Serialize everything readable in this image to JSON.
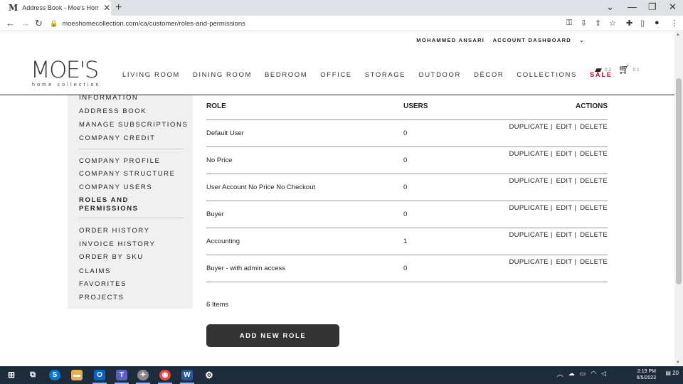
{
  "browser": {
    "tab_title": "Address Book - Moe's Home Coll",
    "tab_favicon": "M",
    "url": "moeshomecollection.com/ca/customer/roles-and-permissions"
  },
  "header": {
    "user_name": "MOHAMMED ANSARI",
    "account_dashboard": "ACCOUNT DASHBOARD",
    "logo_main": "MOE'S",
    "logo_sub": "home collection",
    "nav": [
      "LIVING ROOM",
      "DINING ROOM",
      "BEDROOM",
      "OFFICE",
      "STORAGE",
      "OUTDOOR",
      "DÉCOR",
      "COLLECTIONS",
      "SALE"
    ],
    "folder_count": "0 2",
    "cart_count": "0 1"
  },
  "sidebar": {
    "group1": [
      "INFORMATION",
      "ADDRESS BOOK",
      "MANAGE SUBSCRIPTIONS",
      "COMPANY CREDIT"
    ],
    "group2": [
      "COMPANY PROFILE",
      "COMPANY STRUCTURE",
      "COMPANY USERS"
    ],
    "active": "ROLES AND PERMISSIONS",
    "group3": [
      "ORDER HISTORY",
      "INVOICE HISTORY",
      "ORDER BY SKU",
      "CLAIMS",
      "FAVORITES",
      "PROJECTS"
    ]
  },
  "table": {
    "headers": {
      "role": "ROLE",
      "users": "USERS",
      "actions": "ACTIONS"
    },
    "action_labels": {
      "duplicate": "DUPLICATE",
      "edit": "EDIT",
      "delete": "DELETE",
      "separator": "|"
    },
    "rows": [
      {
        "role": "Default User",
        "users": "0"
      },
      {
        "role": "No Price",
        "users": "0"
      },
      {
        "role": "User Account No Price No Checkout",
        "users": "0"
      },
      {
        "role": "Buyer",
        "users": "0"
      },
      {
        "role": "Accounting",
        "users": "1"
      },
      {
        "role": "Buyer - with admin access",
        "users": "0"
      }
    ],
    "items_count": "6 Items"
  },
  "add_role_button": "ADD NEW ROLE",
  "taskbar": {
    "time": "2:19 PM",
    "date": "6/5/2023",
    "notification_count": "20"
  },
  "colors": {
    "sale": "#d0112b",
    "button_bg": "#333333",
    "sidebar_bg": "#f0f0f0",
    "taskbar_bg": "#1d2b3a"
  }
}
